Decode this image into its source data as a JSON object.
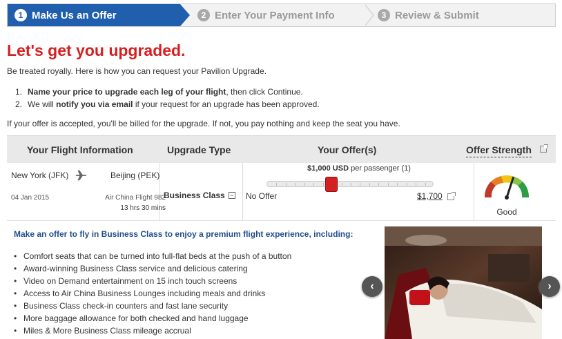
{
  "steps": [
    {
      "num": "1",
      "label": "Make Us an Offer"
    },
    {
      "num": "2",
      "label": "Enter Your Payment Info"
    },
    {
      "num": "3",
      "label": "Review & Submit"
    }
  ],
  "headline": "Let's get you upgraded.",
  "intro": "Be treated royally. Here is how you can request your Pavilion Upgrade.",
  "instructions": [
    {
      "num": "1.",
      "bold": "Name your price to upgrade each leg of your flight",
      "rest": ", then click Continue."
    },
    {
      "num": "2.",
      "pre": "We will ",
      "bold": "notify you via email",
      "rest": " if your request for an upgrade has been approved."
    }
  ],
  "billing_note": "If your offer is accepted, you'll be billed for the upgrade. If not, you pay nothing and keep the seat you have.",
  "table": {
    "headers": {
      "flight": "Your Flight Information",
      "upgrade": "Upgrade Type",
      "offer": "Your Offer(s)",
      "strength": "Offer Strength"
    },
    "flight": {
      "origin": "New York (JFK)",
      "destination": "Beijing (PEK)",
      "date": "04 Jan 2015",
      "flight_number": "Air China Flight 982",
      "duration": "13 hrs 30 mins"
    },
    "upgrade_type": "Business Class",
    "upgrade_toggle": "−",
    "offer": {
      "amount": "$1,000",
      "currency": "USD",
      "per": "per passenger (1)",
      "min_label": "No Offer",
      "max_label": "$1,700",
      "slider_fraction": 0.39
    },
    "strength": {
      "label": "Good",
      "level_fraction": 0.6
    }
  },
  "promo": {
    "title": "Make an offer to fly in Business Class to enjoy a premium flight experience, including:",
    "benefits": [
      "Comfort seats that can be turned into full-flat beds at the push of a button",
      "Award-winning Business Class service and delicious catering",
      "Video on Demand entertainment on 15 inch touch screens",
      "Access to Air China Business Lounges including meals and drinks",
      "Business Class check-in counters and fast lane security",
      "More baggage allowance for both checked and hand luggage",
      "Miles & More Business Class mileage accrual"
    ],
    "prev_label": "‹",
    "next_label": "›"
  },
  "colors": {
    "brand_blue": "#1f5fad",
    "headline_red": "#d81e1e",
    "slider_red": "#d42020",
    "promo_blue": "#1f4e8c"
  }
}
